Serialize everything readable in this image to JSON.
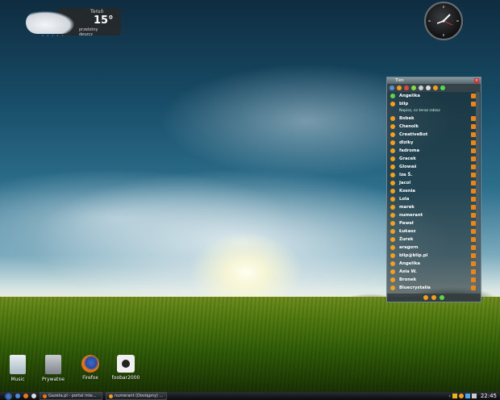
{
  "weather": {
    "city": "Toruń",
    "temperature": "15°",
    "condition": "przelotny deszcz"
  },
  "messenger": {
    "title": "Tlen",
    "contacts": [
      {
        "name": "Angelika",
        "description": ""
      },
      {
        "name": "blip",
        "description": "Napisz, co teraz robisz"
      },
      {
        "name": "Bobek",
        "description": ""
      },
      {
        "name": "Chenolk",
        "description": ""
      },
      {
        "name": "CreativeBot",
        "description": ""
      },
      {
        "name": "dlziky",
        "description": ""
      },
      {
        "name": "fadroma",
        "description": ""
      },
      {
        "name": "Gracek",
        "description": ""
      },
      {
        "name": "Glowaś",
        "description": ""
      },
      {
        "name": "Iza Š.",
        "description": ""
      },
      {
        "name": "Jacol",
        "description": ""
      },
      {
        "name": "Ksenia",
        "description": ""
      },
      {
        "name": "Lola",
        "description": ""
      },
      {
        "name": "marek",
        "description": ""
      },
      {
        "name": "numerant",
        "description": ""
      },
      {
        "name": "Paweł",
        "description": ""
      },
      {
        "name": "Łukasz",
        "description": ""
      },
      {
        "name": "Żurek",
        "description": ""
      },
      {
        "name": "aragorn",
        "description": ""
      },
      {
        "name": "blip@blip.pl",
        "description": ""
      },
      {
        "name": "Angelika",
        "description": ""
      },
      {
        "name": "Asia W.",
        "description": ""
      },
      {
        "name": "Bronek",
        "description": ""
      },
      {
        "name": "Bluecrystalia",
        "description": ""
      }
    ]
  },
  "desktop_icons": [
    {
      "label": "Music"
    },
    {
      "label": "Prywatne"
    },
    {
      "label": "Firefox"
    },
    {
      "label": "foobar2000"
    }
  ],
  "taskbar": {
    "tasks": [
      {
        "label": "Gazeta.pl - portal inte..."
      },
      {
        "label": "numerant (Dostępny) ..."
      }
    ],
    "time": "22:45"
  },
  "colors": {
    "status_online": "#f3a020",
    "taskbar": "#1a1e22",
    "sky_top": "#0f2c40"
  }
}
